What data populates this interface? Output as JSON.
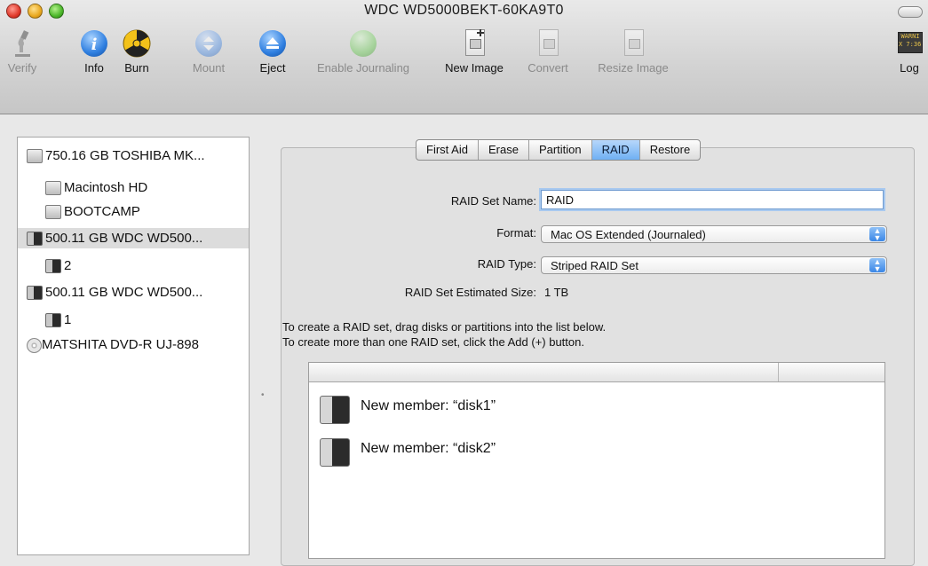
{
  "window": {
    "title": "WDC WD5000BEKT-60KA9T0"
  },
  "toolbar": {
    "items": [
      {
        "label": "Verify",
        "icon": "microscope-icon",
        "enabled": false
      },
      {
        "label": "Info",
        "icon": "info-icon",
        "enabled": true
      },
      {
        "label": "Burn",
        "icon": "burn-icon",
        "enabled": true
      },
      {
        "label": "Mount",
        "icon": "mount-icon",
        "enabled": false
      },
      {
        "label": "Eject",
        "icon": "eject-icon",
        "enabled": true
      },
      {
        "label": "Enable Journaling",
        "icon": "journaling-icon",
        "enabled": false
      },
      {
        "label": "New Image",
        "icon": "new-image-icon",
        "enabled": true
      },
      {
        "label": "Convert",
        "icon": "convert-icon",
        "enabled": false
      },
      {
        "label": "Resize Image",
        "icon": "resize-image-icon",
        "enabled": false
      },
      {
        "label": "Log",
        "icon": "log-icon",
        "enabled": true
      }
    ],
    "log_icon_text": "WARNI\nX 7:36 F"
  },
  "sidebar": {
    "items": [
      {
        "label": "750.16 GB TOSHIBA MK...",
        "icon": "internal-disk-icon",
        "indent": 0,
        "selected": false
      },
      {
        "label": "Macintosh HD",
        "icon": "volume-icon",
        "indent": 1,
        "selected": false
      },
      {
        "label": "BOOTCAMP",
        "icon": "volume-icon",
        "indent": 1,
        "selected": false
      },
      {
        "label": "500.11 GB WDC WD500...",
        "icon": "external-disk-icon",
        "indent": 0,
        "selected": true
      },
      {
        "label": "2",
        "icon": "external-volume-icon",
        "indent": 1,
        "selected": false
      },
      {
        "label": "500.11 GB WDC WD500...",
        "icon": "external-disk-icon",
        "indent": 0,
        "selected": false
      },
      {
        "label": "1",
        "icon": "external-volume-icon",
        "indent": 1,
        "selected": false
      },
      {
        "label": "MATSHITA DVD-R UJ-898",
        "icon": "dvd-icon",
        "indent": 0,
        "selected": false
      }
    ]
  },
  "tabs": {
    "items": [
      "First Aid",
      "Erase",
      "Partition",
      "RAID",
      "Restore"
    ],
    "active": "RAID"
  },
  "raid": {
    "set_name_label": "RAID Set Name:",
    "set_name_value": "RAID",
    "format_label": "Format:",
    "format_value": "Mac OS Extended (Journaled)",
    "type_label": "RAID Type:",
    "type_value": "Striped RAID Set",
    "est_size_label": "RAID Set Estimated Size:",
    "est_size_value": "1 TB",
    "instruction_1": "To create a RAID set, drag disks or partitions into the list below.",
    "instruction_2": "To create more than one RAID set, click the Add (+) button.",
    "members": [
      {
        "label": "New member: “disk1”",
        "icon": "external-disk-icon"
      },
      {
        "label": "New member: “disk2”",
        "icon": "external-disk-icon"
      }
    ]
  },
  "colors": {
    "accent": "#6fb0f3",
    "selection": "#dcdcdc",
    "focus_ring": "#a8c9ef"
  }
}
